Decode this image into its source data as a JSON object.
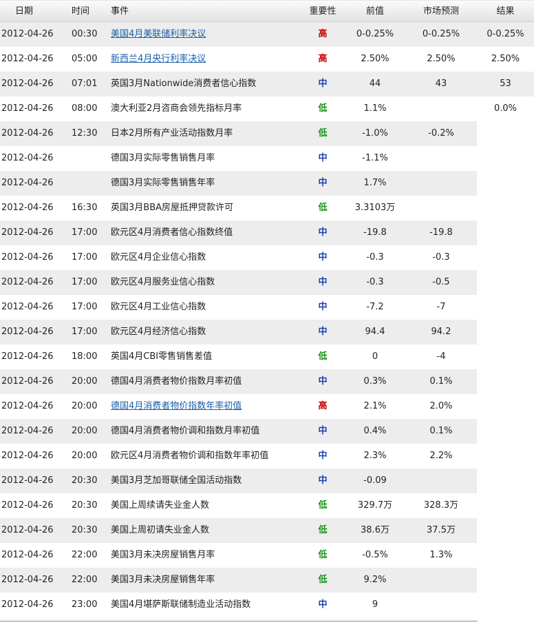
{
  "header": {
    "date": "日期",
    "time": "时间",
    "event": "事件",
    "importance": "重要性",
    "previous": "前值",
    "forecast": "市场预测",
    "result": "结果"
  },
  "importance_colors": {
    "高": "#cc0000",
    "中": "#1a3fb0",
    "低": "#149414"
  },
  "rows": [
    {
      "date": "2012-04-26",
      "time": "00:30",
      "event": "美国4月美联储利率决议",
      "link": true,
      "importance": "高",
      "previous": "0-0.25%",
      "forecast": "0-0.25%",
      "result": "0-0.25%"
    },
    {
      "date": "2012-04-26",
      "time": "05:00",
      "event": "新西兰4月央行利率决议",
      "link": true,
      "importance": "高",
      "previous": "2.50%",
      "forecast": "2.50%",
      "result": "2.50%"
    },
    {
      "date": "2012-04-26",
      "time": "07:01",
      "event": "英国3月Nationwide消费者信心指数",
      "link": false,
      "importance": "中",
      "previous": "44",
      "forecast": "43",
      "result": "53"
    },
    {
      "date": "2012-04-26",
      "time": "08:00",
      "event": "澳大利亚2月咨商会领先指标月率",
      "link": false,
      "importance": "低",
      "previous": "1.1%",
      "forecast": "",
      "result": "0.0%"
    },
    {
      "date": "2012-04-26",
      "time": "12:30",
      "event": "日本2月所有产业活动指数月率",
      "link": false,
      "importance": "低",
      "previous": "-1.0%",
      "forecast": "-0.2%",
      "result": ""
    },
    {
      "date": "2012-04-26",
      "time": "",
      "event": "德国3月实际零售销售月率",
      "link": false,
      "importance": "中",
      "previous": "-1.1%",
      "forecast": "",
      "result": ""
    },
    {
      "date": "2012-04-26",
      "time": "",
      "event": "德国3月实际零售销售年率",
      "link": false,
      "importance": "中",
      "previous": "1.7%",
      "forecast": "",
      "result": ""
    },
    {
      "date": "2012-04-26",
      "time": "16:30",
      "event": "英国3月BBA房屋抵押贷款许可",
      "link": false,
      "importance": "低",
      "previous": "3.3103万",
      "forecast": "",
      "result": ""
    },
    {
      "date": "2012-04-26",
      "time": "17:00",
      "event": "欧元区4月消费者信心指数终值",
      "link": false,
      "importance": "中",
      "previous": "-19.8",
      "forecast": "-19.8",
      "result": ""
    },
    {
      "date": "2012-04-26",
      "time": "17:00",
      "event": "欧元区4月企业信心指数",
      "link": false,
      "importance": "中",
      "previous": "-0.3",
      "forecast": "-0.3",
      "result": ""
    },
    {
      "date": "2012-04-26",
      "time": "17:00",
      "event": "欧元区4月服务业信心指数",
      "link": false,
      "importance": "中",
      "previous": "-0.3",
      "forecast": "-0.5",
      "result": ""
    },
    {
      "date": "2012-04-26",
      "time": "17:00",
      "event": "欧元区4月工业信心指数",
      "link": false,
      "importance": "中",
      "previous": "-7.2",
      "forecast": "-7",
      "result": ""
    },
    {
      "date": "2012-04-26",
      "time": "17:00",
      "event": "欧元区4月经济信心指数",
      "link": false,
      "importance": "中",
      "previous": "94.4",
      "forecast": "94.2",
      "result": ""
    },
    {
      "date": "2012-04-26",
      "time": "18:00",
      "event": "英国4月CBI零售销售差值",
      "link": false,
      "importance": "低",
      "previous": "0",
      "forecast": "-4",
      "result": ""
    },
    {
      "date": "2012-04-26",
      "time": "20:00",
      "event": "德国4月消费者物价指数月率初值",
      "link": false,
      "importance": "中",
      "previous": "0.3%",
      "forecast": "0.1%",
      "result": ""
    },
    {
      "date": "2012-04-26",
      "time": "20:00",
      "event": "德国4月消费者物价指数年率初值",
      "link": true,
      "importance": "高",
      "previous": "2.1%",
      "forecast": "2.0%",
      "result": ""
    },
    {
      "date": "2012-04-26",
      "time": "20:00",
      "event": "德国4月消费者物价调和指数月率初值",
      "link": false,
      "importance": "中",
      "previous": "0.4%",
      "forecast": "0.1%",
      "result": ""
    },
    {
      "date": "2012-04-26",
      "time": "20:00",
      "event": "欧元区4月消费者物价调和指数年率初值",
      "link": false,
      "importance": "中",
      "previous": "2.3%",
      "forecast": "2.2%",
      "result": ""
    },
    {
      "date": "2012-04-26",
      "time": "20:30",
      "event": "美国3月芝加哥联储全国活动指数",
      "link": false,
      "importance": "中",
      "previous": "-0.09",
      "forecast": "",
      "result": ""
    },
    {
      "date": "2012-04-26",
      "time": "20:30",
      "event": "美国上周续请失业金人数",
      "link": false,
      "importance": "低",
      "previous": "329.7万",
      "forecast": "328.3万",
      "result": ""
    },
    {
      "date": "2012-04-26",
      "time": "20:30",
      "event": "美国上周初请失业金人数",
      "link": false,
      "importance": "低",
      "previous": "38.6万",
      "forecast": "37.5万",
      "result": ""
    },
    {
      "date": "2012-04-26",
      "time": "22:00",
      "event": "美国3月未决房屋销售月率",
      "link": false,
      "importance": "低",
      "previous": "-0.5%",
      "forecast": "1.3%",
      "result": ""
    },
    {
      "date": "2012-04-26",
      "time": "22:00",
      "event": "美国3月未决房屋销售年率",
      "link": false,
      "importance": "低",
      "previous": "9.2%",
      "forecast": "",
      "result": ""
    },
    {
      "date": "2012-04-26",
      "time": "23:00",
      "event": "美国4月堪萨斯联储制造业活动指数",
      "link": false,
      "importance": "中",
      "previous": "9",
      "forecast": "",
      "result": ""
    }
  ]
}
